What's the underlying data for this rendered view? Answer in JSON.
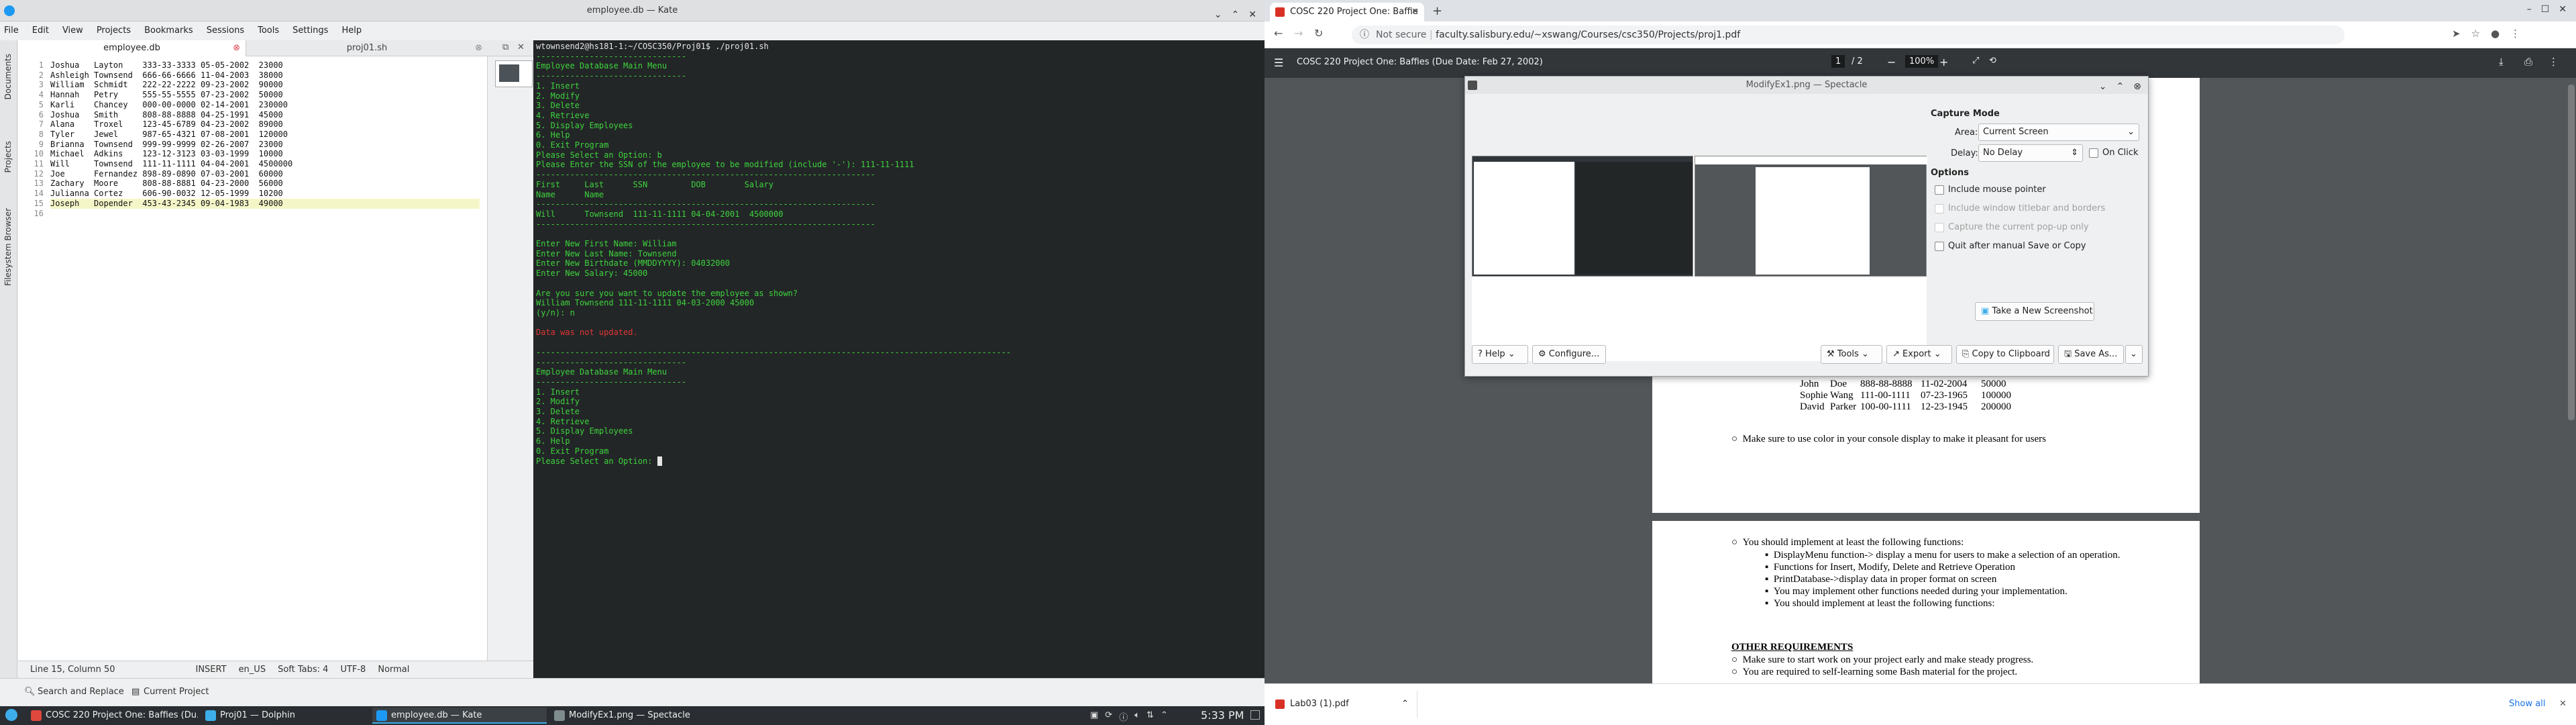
{
  "kate": {
    "title": "employee.db — Kate",
    "menu": [
      "File",
      "Edit",
      "View",
      "Projects",
      "Bookmarks",
      "Sessions",
      "Tools",
      "Settings",
      "Help"
    ],
    "side_tabs": [
      "Documents",
      "Projects",
      "Filesystem Browser"
    ],
    "tabs": [
      "employee.db",
      "proj01.sh"
    ],
    "lines": [
      "Joshua   Layton    333-33-3333 05-05-2002  23000",
      "Ashleigh Townsend  666-66-6666 11-04-2003  38000",
      "William  Schmidt   222-22-2222 09-23-2002  90000",
      "Hannah   Petry     555-55-5555 07-23-2002  50000",
      "Karli    Chancey   000-00-0000 02-14-2001  230000",
      "Joshua   Smith     808-88-8888 04-25-1991  45000",
      "Alana    Troxel    123-45-6789 04-23-2002  89000",
      "Tyler    Jewel     987-65-4321 07-08-2001  120000",
      "Brianna  Townsend  999-99-9999 02-26-2007  23000",
      "Michael  Adkins    123-12-3123 03-03-1999  10000",
      "Will     Townsend  111-11-1111 04-04-2001  4500000",
      "Joe      Fernandez 898-89-0890 07-03-2001  60000",
      "Zachary  Moore     808-88-8881 04-23-2000  56000",
      "Julianna Cortez    606-90-0032 12-05-1999  10200",
      "Joseph   Dopender  453-43-2345 09-04-1983  49000",
      ""
    ],
    "status": {
      "position": "Line 15, Column 50",
      "mode": "INSERT",
      "lang": "en_US",
      "indent": "Soft Tabs: 4",
      "encoding": "UTF-8",
      "filetype": "Normal"
    },
    "bottom": {
      "search": "Search and Replace",
      "project": "Current Project"
    },
    "terminal": [
      {
        "c": "w",
        "t": "wtownsend2@hs181-1:~/COSC350/Proj01$ ./proj01.sh"
      },
      {
        "c": "g",
        "t": "-------------------------------"
      },
      {
        "c": "g",
        "t": "Employee Database Main Menu"
      },
      {
        "c": "g",
        "t": "-------------------------------"
      },
      {
        "c": "g",
        "t": "1. Insert"
      },
      {
        "c": "g",
        "t": "2. Modify"
      },
      {
        "c": "g",
        "t": "3. Delete"
      },
      {
        "c": "g",
        "t": "4. Retrieve"
      },
      {
        "c": "g",
        "t": "5. Display Employees"
      },
      {
        "c": "g",
        "t": "6. Help"
      },
      {
        "c": "g",
        "t": "0. Exit Program"
      },
      {
        "c": "g",
        "t": "Please Select an Option: b"
      },
      {
        "c": "g",
        "t": "Please Enter the SSN of the employee to be modified (include '-'): 111-11-1111"
      },
      {
        "c": "g",
        "t": "----------------------------------------------------------------------"
      },
      {
        "c": "g",
        "t": "First     Last      SSN         DOB        Salary"
      },
      {
        "c": "g",
        "t": "Name      Name"
      },
      {
        "c": "g",
        "t": "----------------------------------------------------------------------"
      },
      {
        "c": "g",
        "t": "Will      Townsend  111-11-1111 04-04-2001  4500000"
      },
      {
        "c": "g",
        "t": "----------------------------------------------------------------------"
      },
      {
        "c": "g",
        "t": ""
      },
      {
        "c": "g",
        "t": "Enter New First Name: William"
      },
      {
        "c": "g",
        "t": "Enter New Last Name: Townsend"
      },
      {
        "c": "g",
        "t": "Enter New Birthdate (MMDDYYYY): 04032000"
      },
      {
        "c": "g",
        "t": "Enter New Salary: 45000"
      },
      {
        "c": "g",
        "t": ""
      },
      {
        "c": "g",
        "t": "Are you sure you want to update the employee as shown?"
      },
      {
        "c": "g",
        "t": "William Townsend 111-11-1111 04-03-2000 45000"
      },
      {
        "c": "g",
        "t": "(y/n): n"
      },
      {
        "c": "g",
        "t": ""
      },
      {
        "c": "r",
        "t": "Data was not updated."
      },
      {
        "c": "g",
        "t": ""
      },
      {
        "c": "g",
        "t": "--------------------------------------------------------------------------------------------------"
      },
      {
        "c": "g",
        "t": "-------------------------------"
      },
      {
        "c": "g",
        "t": "Employee Database Main Menu"
      },
      {
        "c": "g",
        "t": "-------------------------------"
      },
      {
        "c": "g",
        "t": "1. Insert"
      },
      {
        "c": "g",
        "t": "2. Modify"
      },
      {
        "c": "g",
        "t": "3. Delete"
      },
      {
        "c": "g",
        "t": "4. Retrieve"
      },
      {
        "c": "g",
        "t": "5. Display Employees"
      },
      {
        "c": "g",
        "t": "6. Help"
      },
      {
        "c": "g",
        "t": "0. Exit Program"
      },
      {
        "c": "g",
        "t": "Please Select an Option: "
      }
    ],
    "terminal_label": "Terminal"
  },
  "taskbar": {
    "tasks": [
      {
        "label": "COSC 220 Project One: Baffies (Du...",
        "color": "#e0483e"
      },
      {
        "label": "Proj01 — Dolphin",
        "color": "#3daee9"
      },
      {
        "label": "employee.db — Kate",
        "color": "#1d99f3"
      },
      {
        "label": "ModifyEx1.png — Spectacle",
        "color": "#7f8c8d"
      }
    ],
    "clock": "5:33 PM"
  },
  "browser": {
    "tab_title": "COSC 220 Project One: Baffie",
    "security": "Not secure",
    "url": "faculty.salisbury.edu/~xswang/Courses/csc350/Projects/proj1.pdf",
    "pdf_title": "COSC 220 Project One: Baffies (Due Date: Feb 27, 2002)",
    "page_current": "1",
    "page_total": "/ 2",
    "zoom": "100%",
    "table_rows": [
      [
        "John",
        "Doe",
        "888-88-8888",
        "11-02-2004",
        "50000"
      ],
      [
        "Sophie",
        "Wang",
        "111-00-1111",
        "07-23-1965",
        "100000"
      ],
      [
        "David",
        "Parker",
        "100-00-1111",
        "12-23-1945",
        "200000"
      ]
    ],
    "bullet_color": "Make sure to use color in your console display to make it pleasant for users",
    "implement_title": "You should implement at least the following functions:",
    "implement_items": [
      "DisplayMenu function-> display a menu for users to make a selection of an operation.",
      "Functions for Insert, Modify, Delete and Retrieve Operation",
      "PrintDatabase->display data in proper format on screen",
      "You may implement other functions needed during your implementation.",
      "You should implement at least the following functions:"
    ],
    "other_title": "OTHER REQUIREMENTS",
    "other_items": [
      "Make sure to start work on your project early and make steady progress.",
      "You are required to self-learning some Bash material for the project."
    ],
    "download_file": "Lab03 (1).pdf",
    "show_all": "Show all"
  },
  "spectacle": {
    "title": "ModifyEx1.png — Spectacle",
    "capture_mode": "Capture Mode",
    "area_label": "Area:",
    "area_value": "Current Screen",
    "delay_label": "Delay:",
    "delay_value": "No Delay",
    "on_click": "On Click",
    "options": "Options",
    "opt_mouse": "Include mouse pointer",
    "opt_titlebar": "Include window titlebar and borders",
    "opt_popup": "Capture the current pop-up only",
    "opt_quit": "Quit after manual Save or Copy",
    "new_shot": "Take a New Screenshot",
    "help": "Help",
    "configure": "Configure...",
    "tools": "Tools",
    "export": "Export",
    "copy": "Copy to Clipboard",
    "save": "Save As..."
  }
}
